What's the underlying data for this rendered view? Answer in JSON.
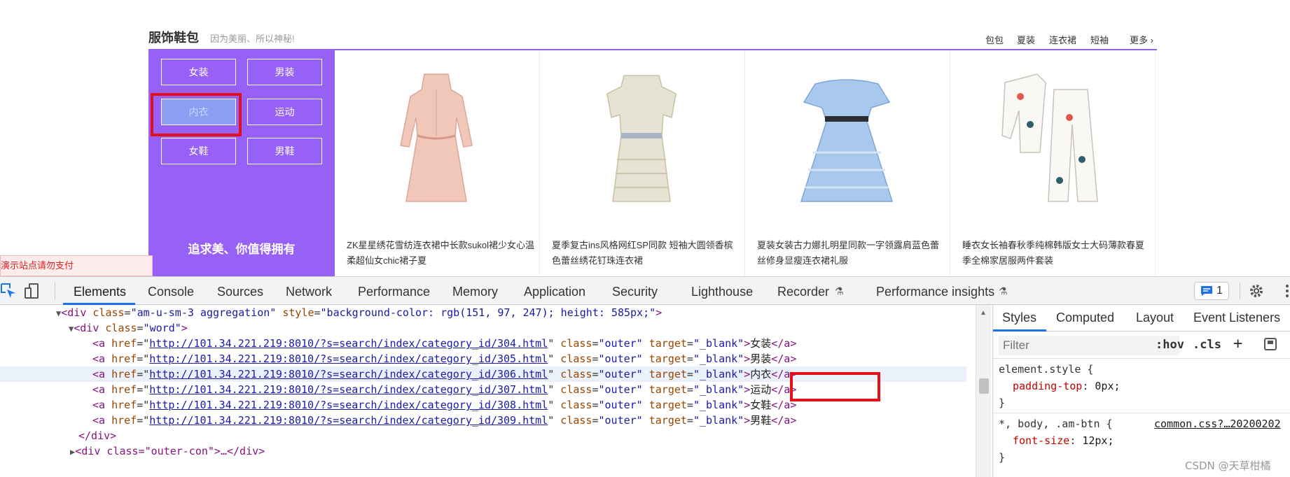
{
  "section": {
    "title": "服饰鞋包",
    "subtitle": "因为美丽、所以神秘!",
    "nav": [
      "包包",
      "夏装",
      "连衣裙",
      "短袖"
    ],
    "more": "更多 ›",
    "accent_color": "#9761f7"
  },
  "aggregation": {
    "categories": [
      "女装",
      "男装",
      "内衣",
      "运动",
      "女鞋",
      "男鞋"
    ],
    "highlighted_category": "内衣",
    "slogan": "追求美、你值得拥有"
  },
  "products": [
    {
      "name": "ZK星星绣花雪纺连衣裙中长款sukol裙少女心温柔超仙女chic裙子夏",
      "image": "pink-dress-image"
    },
    {
      "name": "夏季复古ins风格网红SP同款 短袖大圆领香槟色蕾丝绣花钉珠连衣裙",
      "image": "lace-dress-image"
    },
    {
      "name": "夏装女装古力娜扎明星同款一字领露肩蓝色蕾丝修身显瘦连衣裙礼服",
      "image": "blue-dress-image"
    },
    {
      "name": "睡衣女长袖春秋季纯棉韩版女士大码薄款春夏季全棉家居服两件套装",
      "image": "pajama-image"
    }
  ],
  "warning_text": "演示站点请勿支付",
  "devtools": {
    "tabs": [
      "Elements",
      "Console",
      "Sources",
      "Network",
      "Performance",
      "Memory",
      "Application",
      "Security",
      "Lighthouse",
      "Recorder",
      "Performance insights"
    ],
    "active_tab": "Elements",
    "issues_count": "1",
    "dom": {
      "line1": {
        "tag_open": "<div ",
        "a1": "class",
        "v1": "\"am-u-sm-3 aggregation\"",
        "a2": "style",
        "v2": "\"background-color: rgb(151, 97, 247); height: 585px;\"",
        "tag_close": ">"
      },
      "line2": {
        "tag_open": "<div ",
        "a1": "class",
        "v1": "\"word\"",
        "tag_close": ">"
      },
      "links": [
        {
          "href": "http://101.34.221.219:8010/?s=search/index/category_id/304.html",
          "text": "女装"
        },
        {
          "href": "http://101.34.221.219:8010/?s=search/index/category_id/305.html",
          "text": "男装"
        },
        {
          "href": "http://101.34.221.219:8010/?s=search/index/category_id/306.html",
          "text": "内衣"
        },
        {
          "href": "http://101.34.221.219:8010/?s=search/index/category_id/307.html",
          "text": "运动"
        },
        {
          "href": "http://101.34.221.219:8010/?s=search/index/category_id/308.html",
          "text": "女鞋"
        },
        {
          "href": "http://101.34.221.219:8010/?s=search/index/category_id/309.html",
          "text": "男鞋"
        }
      ],
      "link_class_value": "\"outer\"",
      "link_target_value": "\"_blank\"",
      "close_div": "</div>",
      "next_div": "<div class=\"outer-con\">…</div>"
    },
    "styles": {
      "tabs": [
        "Styles",
        "Computed",
        "Layout",
        "Event Listeners"
      ],
      "active_tab": "Styles",
      "filter_placeholder": "Filter",
      "hov": ":hov",
      "cls": ".cls",
      "rule1": {
        "selector": "element.style {",
        "prop": "padding-top",
        "value": "0px;"
      },
      "rule2": {
        "selector": "*, body, .am-btn {",
        "source": "common.css?…20200202",
        "prop": "font-size",
        "value": "12px;"
      }
    }
  },
  "watermark": "CSDN @天草柑橘"
}
